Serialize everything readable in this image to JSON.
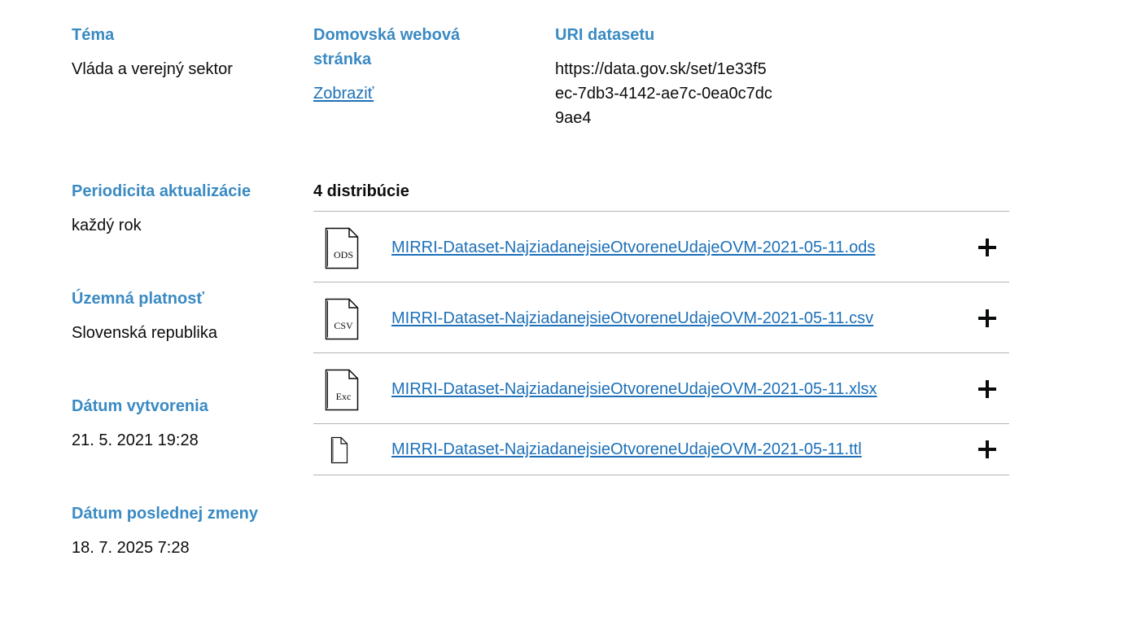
{
  "meta": {
    "tema": {
      "heading": "Téma",
      "value": "Vláda a verejný sektor"
    },
    "homepage": {
      "heading": "Domovská webová stránka",
      "link_label": "Zobraziť"
    },
    "uri": {
      "heading": "URI datasetu",
      "value": "https://data.gov.sk/set/1e33f5ec-7db3-4142-ae7c-0ea0c7dc9ae4"
    },
    "periodicity": {
      "heading": "Periodicita aktualizácie",
      "value": "každý rok"
    },
    "territory": {
      "heading": "Územná platnosť",
      "value": "Slovenská republika"
    },
    "created": {
      "heading": "Dátum vytvorenia",
      "value": "21. 5. 2021 19:28"
    },
    "modified": {
      "heading": "Dátum poslednej zmeny",
      "value": "18. 7. 2025 7:28"
    }
  },
  "distributions": {
    "count_label": "4 distribúcie",
    "items": [
      {
        "icon_text": "ODS",
        "icon": "ods-file-icon",
        "name": "MIRRI-Dataset-NajziadanejsieOtvoreneUdajeOVM-2021-05-11.ods"
      },
      {
        "icon_text": "CSV",
        "icon": "csv-file-icon",
        "name": "MIRRI-Dataset-NajziadanejsieOtvoreneUdajeOVM-2021-05-11.csv"
      },
      {
        "icon_text": "Exc",
        "icon": "excel-file-icon",
        "name": "MIRRI-Dataset-NajziadanejsieOtvoreneUdajeOVM-2021-05-11.xlsx"
      },
      {
        "icon_text": "",
        "icon": "generic-file-icon",
        "name": "MIRRI-Dataset-NajziadanejsieOtvoreneUdajeOVM-2021-05-11.ttl"
      }
    ]
  },
  "colors": {
    "heading": "#3a8ac3",
    "link": "#1d70b8",
    "text": "#0b0c0c",
    "divider": "#b1b4b6"
  }
}
